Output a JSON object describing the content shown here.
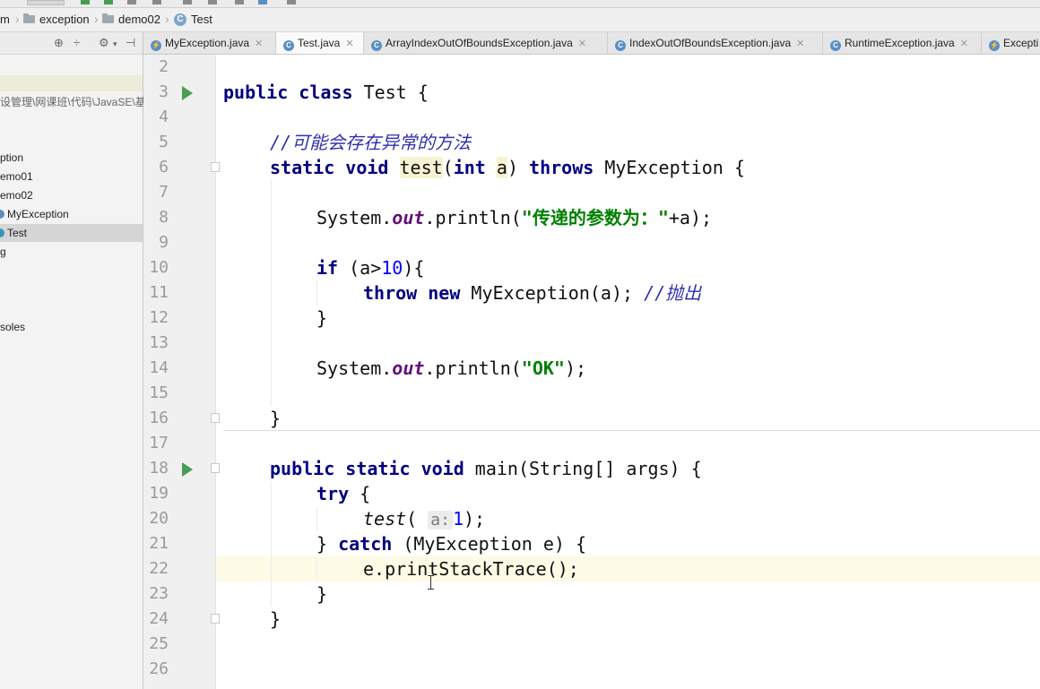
{
  "breadcrumbs": [
    {
      "label": "m"
    },
    {
      "label": "exception"
    },
    {
      "label": "demo02"
    },
    {
      "label": "Test"
    }
  ],
  "sidebar": {
    "path_text": "设管理\\网课班\\代码\\JavaSE\\基",
    "items": [
      {
        "label": "ption"
      },
      {
        "label": "emo01"
      },
      {
        "label": "emo02"
      },
      {
        "label": "MyException"
      },
      {
        "label": "Test"
      },
      {
        "label": "g"
      },
      {
        "label": "soles"
      }
    ]
  },
  "tabs": [
    {
      "label": "MyException.java",
      "icon": "exception-class-icon"
    },
    {
      "label": "Test.java",
      "icon": "class-icon",
      "active": true
    },
    {
      "label": "ArrayIndexOutOfBoundsException.java",
      "icon": "class-icon"
    },
    {
      "label": "IndexOutOfBoundsException.java",
      "icon": "class-icon"
    },
    {
      "label": "RuntimeException.java",
      "icon": "class-icon"
    },
    {
      "label": "Excepti",
      "icon": "exception-class-icon"
    }
  ],
  "editor": {
    "current_line": 22,
    "lines": [
      {
        "n": "2"
      },
      {
        "n": "3"
      },
      {
        "n": "4"
      },
      {
        "n": "5"
      },
      {
        "n": "6"
      },
      {
        "n": "7"
      },
      {
        "n": "8"
      },
      {
        "n": "9"
      },
      {
        "n": "10"
      },
      {
        "n": "11"
      },
      {
        "n": "12"
      },
      {
        "n": "13"
      },
      {
        "n": "14"
      },
      {
        "n": "15"
      },
      {
        "n": "16"
      },
      {
        "n": "17"
      },
      {
        "n": "18"
      },
      {
        "n": "19"
      },
      {
        "n": "20"
      },
      {
        "n": "21"
      },
      {
        "n": "22"
      },
      {
        "n": "23"
      },
      {
        "n": "24"
      },
      {
        "n": "25"
      },
      {
        "n": "26"
      }
    ],
    "code": {
      "l3_kw": "public class",
      "l3_rest": " Test {",
      "l5_comment": "//可能会存在异常的方法",
      "l6_kw1": "static void",
      "l6_name": "test",
      "l6_p1": "(",
      "l6_kw2": "int",
      "l6_p2": " ",
      "l6_param": "a",
      "l6_p3": ") ",
      "l6_kw3": "throws",
      "l6_rest": " MyException {",
      "l8_a": "System.",
      "l8_out": "out",
      "l8_b": ".println(",
      "l8_str": "\"传递的参数为：\"",
      "l8_c": "+a);",
      "l10_kw": "if",
      "l10_a": " (a>",
      "l10_num": "10",
      "l10_b": "){",
      "l11_kw": "throw new",
      "l11_a": " MyException(a); ",
      "l11_comment": "//抛出",
      "l12": "}",
      "l14_a": "System.",
      "l14_out": "out",
      "l14_b": ".println(",
      "l14_str": "\"OK\"",
      "l14_c": ");",
      "l16": "}",
      "l18_kw": "public static void",
      "l18_rest": " main(String[] args) {",
      "l19_kw": "try",
      "l19_rest": " {",
      "l20_call": "test",
      "l20_p": "(",
      "l20_hint": "a:",
      "l20_num": "1",
      "l20_end": ");",
      "l21_a": "} ",
      "l21_kw": "catch",
      "l21_rest": " (MyException e) {",
      "l22": "e.printStackTrace();",
      "l23": "}",
      "l24": "}"
    }
  }
}
